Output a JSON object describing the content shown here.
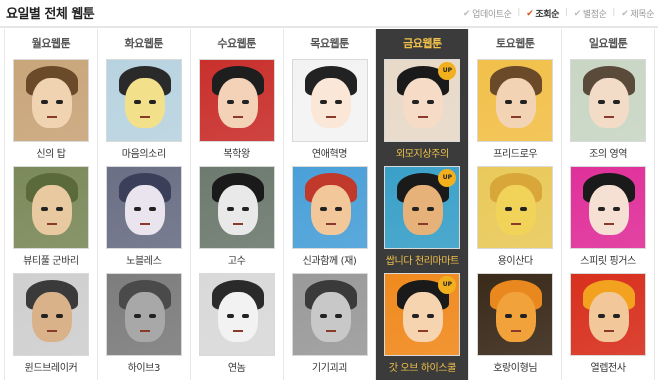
{
  "header": {
    "title": "요일별 전체 웹툰",
    "sort_options": [
      {
        "label": "업데이트순",
        "active": false
      },
      {
        "label": "조회순",
        "active": true
      },
      {
        "label": "별점순",
        "active": false
      },
      {
        "label": "제목순",
        "active": false
      }
    ]
  },
  "up_badge": "UP",
  "days": [
    {
      "label": "월요웹툰",
      "selected": false,
      "items": [
        {
          "title": "신의 탑",
          "bg": "#c9a57a",
          "hair": "#6b4a2a",
          "skin": "#f0d3b0"
        },
        {
          "title": "뷰티풀 군바리",
          "bg": "#7b8a5a",
          "hair": "#5a6a3a",
          "skin": "#e8c9a0"
        },
        {
          "title": "윈드브레이커",
          "bg": "#cfcfcf",
          "hair": "#3a3a3a",
          "skin": "#d9b28a"
        }
      ]
    },
    {
      "label": "화요웹툰",
      "selected": false,
      "items": [
        {
          "title": "마음의소리",
          "bg": "#b8d3e0",
          "hair": "#2a2a2a",
          "skin": "#f2e08a"
        },
        {
          "title": "노블레스",
          "bg": "#6a6f85",
          "hair": "#3b3f5a",
          "skin": "#e9e4ee"
        },
        {
          "title": "하이브3",
          "bg": "#7d7d7d",
          "hair": "#4a4a4a",
          "skin": "#a8a8a8"
        }
      ]
    },
    {
      "label": "수요웹툰",
      "selected": false,
      "items": [
        {
          "title": "복학왕",
          "bg": "#c9302c",
          "hair": "#1e1e1e",
          "skin": "#f3d2b8"
        },
        {
          "title": "고수",
          "bg": "#6d7a6e",
          "hair": "#1a1a1a",
          "skin": "#e9e9e9"
        },
        {
          "title": "연놈",
          "bg": "#d9d9d9",
          "hair": "#2a2a2a",
          "skin": "#f2f2f2"
        }
      ]
    },
    {
      "label": "목요웹툰",
      "selected": false,
      "items": [
        {
          "title": "연애혁명",
          "bg": "#f3f3f3",
          "hair": "#222222",
          "skin": "#fbe7d8"
        },
        {
          "title": "신과함께 (재)",
          "bg": "#4aa0d8",
          "hair": "#c0392b",
          "skin": "#f2c89a"
        },
        {
          "title": "기기괴괴",
          "bg": "#9a9a9a",
          "hair": "#3a3a3a",
          "skin": "#c8c8c8"
        }
      ]
    },
    {
      "label": "금요웹툰",
      "selected": true,
      "items": [
        {
          "title": "외모지상주의",
          "bg": "#e8d9c8",
          "hair": "#1a1a1a",
          "skin": "#f6dcc6",
          "up": true
        },
        {
          "title": "쌉니다 천리마마트",
          "bg": "#3aa0c8",
          "hair": "#1a1a1a",
          "skin": "#e7b27a",
          "up": true
        },
        {
          "title": "갓 오브 하이스쿨",
          "bg": "#f08a1e",
          "hair": "#1a1a1a",
          "skin": "#f6d4b0",
          "up": true
        }
      ]
    },
    {
      "label": "토요웹툰",
      "selected": false,
      "items": [
        {
          "title": "프리드로우",
          "bg": "#f2c04a",
          "hair": "#6b4a2a",
          "skin": "#f2d4b4"
        },
        {
          "title": "용이산다",
          "bg": "#e9c95a",
          "hair": "#d9a63a",
          "skin": "#f2d35a"
        },
        {
          "title": "호랑이형님",
          "bg": "#3a2a1a",
          "hair": "#e8881e",
          "skin": "#f2a23a"
        }
      ]
    },
    {
      "label": "일요웹툰",
      "selected": false,
      "items": [
        {
          "title": "조의 영역",
          "bg": "#c9d6c4",
          "hair": "#5a4a3a",
          "skin": "#f2dcc8"
        },
        {
          "title": "스피릿 핑거스",
          "bg": "#e0309a",
          "hair": "#1a1a1a",
          "skin": "#f6e0d4"
        },
        {
          "title": "열렙전사",
          "bg": "#d8301e",
          "hair": "#f2a21e",
          "skin": "#f2c89a"
        }
      ]
    }
  ]
}
